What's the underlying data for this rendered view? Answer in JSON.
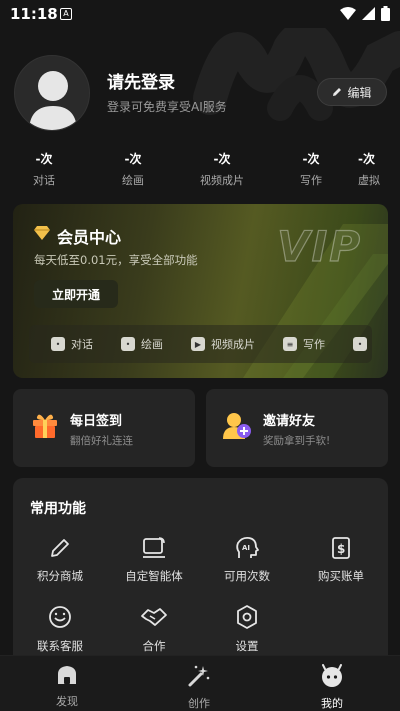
{
  "status_bar": {
    "time": "11:18",
    "notif": "A"
  },
  "profile": {
    "title": "请先登录",
    "subtitle": "登录可免费享受AI服务",
    "edit_label": "编辑"
  },
  "stats": [
    {
      "value": "-次",
      "label": "对话"
    },
    {
      "value": "-次",
      "label": "绘画"
    },
    {
      "value": "-次",
      "label": "视频成片"
    },
    {
      "value": "-次",
      "label": "写作"
    },
    {
      "value": "-次",
      "label": "虚拟"
    }
  ],
  "vip": {
    "title": "会员中心",
    "subtitle": "每天低至0.01元，享受全部功能",
    "button": "立即开通",
    "watermark": "VIP",
    "features": [
      "对话",
      "绘画",
      "视频成片",
      "写作"
    ]
  },
  "cards": {
    "checkin": {
      "title": "每日签到",
      "subtitle": "翻倍好礼连连"
    },
    "invite": {
      "title": "邀请好友",
      "subtitle": "奖励拿到手软!"
    }
  },
  "functions": {
    "title": "常用功能",
    "items": [
      "积分商城",
      "自定智能体",
      "可用次数",
      "购买账单",
      "联系客服",
      "合作",
      "设置"
    ]
  },
  "tabs": [
    {
      "label": "发现",
      "active": false
    },
    {
      "label": "创作",
      "active": false
    },
    {
      "label": "我的",
      "active": true
    }
  ]
}
